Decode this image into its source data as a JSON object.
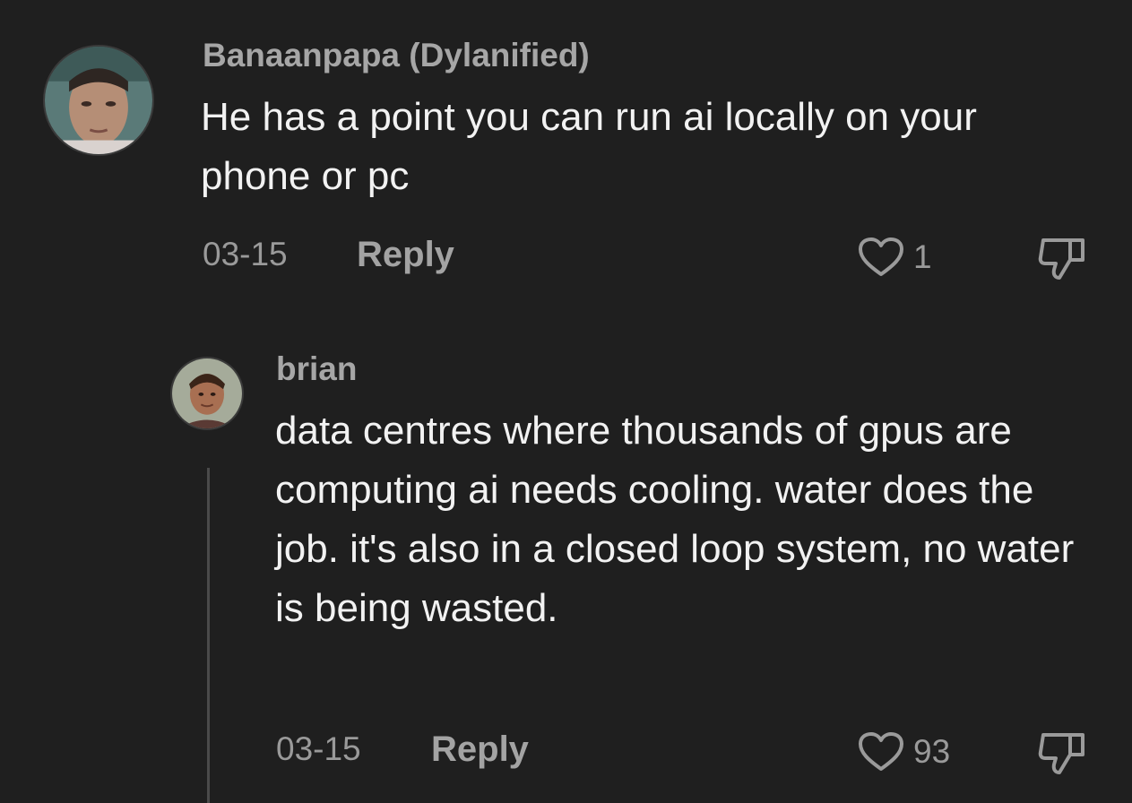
{
  "colors": {
    "background": "#1f1f1f",
    "username": "#a6a6a6",
    "comment_text": "#f2f2f2",
    "meta_text": "#9a9a9a",
    "thread_line": "#4a4a4a"
  },
  "comments": [
    {
      "username": "Banaanpapa (Dylanified)",
      "text": "He has a point you can run ai locally on your phone or pc",
      "date": "03-15",
      "reply_label": "Reply",
      "likes": "1",
      "like_icon": "heart-icon",
      "dislike_icon": "thumbs-down-icon"
    },
    {
      "username": "brian",
      "text": "data centres where thousands of gpus are computing ai needs cooling. water does the job. it's also in a closed loop system, no water is being wasted.",
      "date": "03-15",
      "reply_label": "Reply",
      "likes": "93",
      "like_icon": "heart-icon",
      "dislike_icon": "thumbs-down-icon"
    }
  ]
}
